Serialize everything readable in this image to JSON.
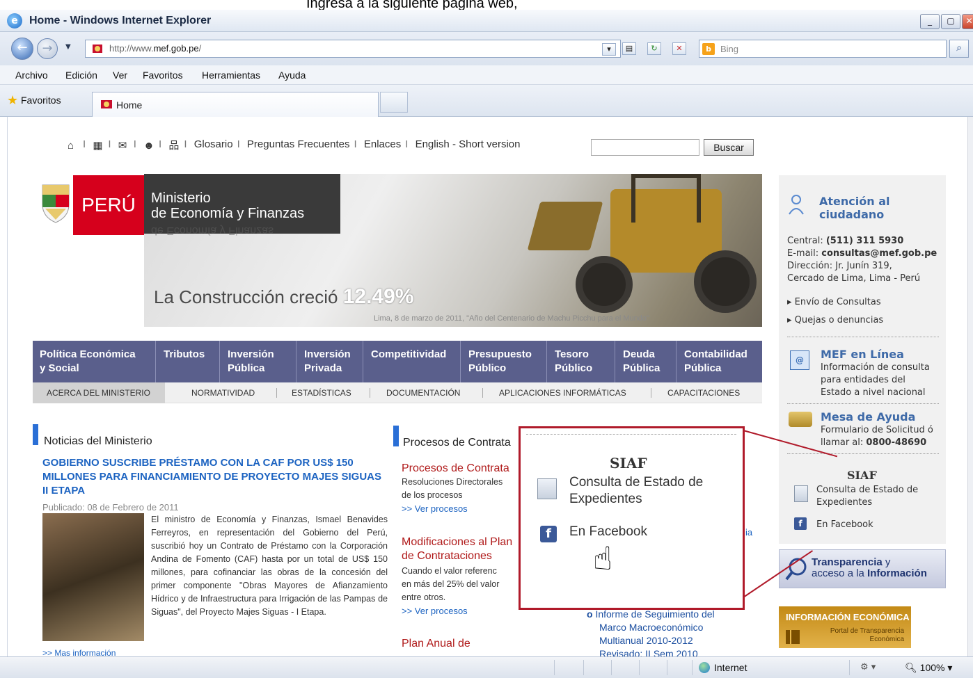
{
  "instruction": "Ingresa a la siguiente página web,",
  "window": {
    "title": "Home - Windows Internet Explorer"
  },
  "address_bar": {
    "prefix": "http://www.",
    "domain": "mef.gob.pe",
    "suffix": "/"
  },
  "search": {
    "placeholder": "Bing",
    "provider_icon": "bing-icon"
  },
  "menu": [
    "Archivo",
    "Edición",
    "Ver",
    "Favoritos",
    "Herramientas",
    "Ayuda"
  ],
  "favorites_label": "Favoritos",
  "tab": {
    "label": "Home"
  },
  "top_links": [
    "Glosario",
    "Preguntas Frecuentes",
    "Enlaces",
    "English - Short version"
  ],
  "site_search_button": "Buscar",
  "header": {
    "peru": "PERÚ",
    "ministry_line1": "Ministerio",
    "ministry_line2": "de Economía y Finanzas",
    "headline_prefix": "La Construcción creció",
    "headline_value": "12.49%",
    "date_line": "Lima, 8 de marzo de 2011,  \"Año del Centenario de Machu Picchu para el Mundo\""
  },
  "main_nav": [
    [
      "Política Económica",
      "y Social"
    ],
    [
      "Tributos",
      ""
    ],
    [
      "Inversión",
      "Pública"
    ],
    [
      "Inversión",
      "Privada"
    ],
    [
      "Competitividad",
      ""
    ],
    [
      "Presupuesto",
      "Público"
    ],
    [
      "Tesoro",
      "Público"
    ],
    [
      "Deuda",
      "Pública"
    ],
    [
      "Contabilidad",
      "Pública"
    ]
  ],
  "sub_nav": [
    "ACERCA DEL MINISTERIO",
    "NORMATIVIDAD",
    "ESTADÍSTICAS",
    "DOCUMENTACIÓN",
    "APLICACIONES INFORMÁTICAS",
    "CAPACITACIONES"
  ],
  "sidebar": {
    "atencion_l1": "Atención al",
    "atencion_l2": "ciudadano",
    "central_label": "Central: ",
    "central_value": "(511) 311 5930",
    "email_label": "E-mail: ",
    "email_value": "consultas@mef.gob.pe",
    "direccion": "Dirección: Jr. Junín 319,",
    "direccion2": "Cercado de Lima, Lima - Perú",
    "link1": "Envío de Consultas",
    "link2": "Quejas o denuncias",
    "mef_title": "MEF en Línea",
    "mef_l1": "Información de consulta",
    "mef_l2": "para entidades del",
    "mef_l3": "Estado a nivel nacional",
    "mesa_title": "Mesa de Ayuda",
    "mesa_l1": "Formulario de Solicitud ó",
    "mesa_l2_prefix": "llamar al: ",
    "mesa_l2_value": "0800-48690",
    "siaf_title": "SIAF",
    "siaf_l1": "Consulta de Estado de",
    "siaf_l2": "Expedientes",
    "facebook": "En Facebook",
    "trans_l1a": "Transparencia",
    "trans_l1b": " y",
    "trans_l2a": "acceso a la ",
    "trans_l2b": "Información",
    "infoeco_title": "INFORMACIÓN ECONÓMICA",
    "infoeco_sub1": "Portal de Transparencia",
    "infoeco_sub2": "Económica"
  },
  "news": {
    "section_title": "Noticias del Ministerio",
    "headline": "GOBIERNO SUSCRIBE PRÉSTAMO CON LA CAF POR US$ 150 MILLONES PARA FINANCIAMIENTO DE PROYECTO MAJES SIGUAS II ETAPA",
    "date": "Publicado: 08 de Febrero de 2011",
    "body": "El ministro de Economía y Finanzas, Ismael Benavides Ferreyros, en representación del Gobierno del Perú, suscribió hoy un Contrato de Préstamo con la Corporación Andina de Fomento (CAF) hasta por un total de US$ 150 millones, para cofinanciar las obras de la concesión del primer componente \"Obras Mayores de Afianzamiento Hídrico y de Infraestructura para Irrigación de las Pampas de Siguas\", del Proyecto Majes Siguas - I Etapa.",
    "more": ">> Mas información"
  },
  "procesos": {
    "section_title": "Procesos de Contrata",
    "h1": "Procesos de Contrata",
    "t1": "Resoluciones Directorales",
    "t2": "de los procesos",
    "link": ">> Ver procesos",
    "h2a": "Modificaciones al Plan",
    "h2b": "de Contrataciones",
    "t3": "Cuando el valor referenc",
    "t4": "en más del 25% del valor",
    "t5": "entre otros.",
    "h3": "Plan Anual de"
  },
  "col3_partial": "ia",
  "report": {
    "bullet": "o",
    "l1": "Informe de Seguimiento del",
    "l2": "Marco Macroeconómico",
    "l3": "Multianual 2010-2012",
    "l4": "Revisado: II Sem 2010"
  },
  "callout": {
    "siaf": "SIAF",
    "l1": "Consulta de Estado de",
    "l2": "Expedientes",
    "facebook": "En Facebook"
  },
  "status": {
    "zone": "Internet",
    "zoom": "100%"
  },
  "colors": {
    "accent_red": "#b01a2a",
    "nav_purple": "#5a5f8c",
    "link_blue": "#1c63c1"
  }
}
